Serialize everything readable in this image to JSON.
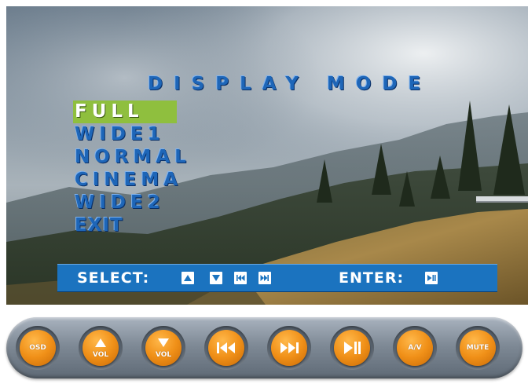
{
  "osd": {
    "title": "DISPLAY MODE",
    "items": [
      {
        "label": "FULL",
        "selected": true
      },
      {
        "label": "WIDE1",
        "selected": false
      },
      {
        "label": "NORMAL",
        "selected": false
      },
      {
        "label": "CINEMA",
        "selected": false
      },
      {
        "label": "WIDE2",
        "selected": false
      },
      {
        "label": "EXIT",
        "selected": false
      }
    ]
  },
  "status_bar": {
    "select_label": "SELECT:",
    "select_icons": [
      "up-key-icon",
      "down-key-icon",
      "rewind-key-icon",
      "fast-forward-key-icon"
    ],
    "enter_label": "ENTER:",
    "enter_icon": "play-pause-key-icon"
  },
  "remote": {
    "buttons": [
      {
        "name": "osd-button",
        "label": "OSD",
        "icon": "none"
      },
      {
        "name": "vol-up-button",
        "label": "VOL",
        "icon": "triangle-up-icon"
      },
      {
        "name": "vol-down-button",
        "label": "VOL",
        "icon": "triangle-down-icon"
      },
      {
        "name": "previous-button",
        "label": "",
        "icon": "skip-previous-icon"
      },
      {
        "name": "next-button",
        "label": "",
        "icon": "skip-next-icon"
      },
      {
        "name": "play-pause-button",
        "label": "",
        "icon": "play-pause-icon"
      },
      {
        "name": "av-button",
        "label": "A/V",
        "icon": "none"
      },
      {
        "name": "mute-button",
        "label": "MUTE",
        "icon": "none"
      }
    ]
  },
  "colors": {
    "menu_text": "#1e66b8",
    "selected_highlight": "#8fbf3e",
    "status_bar": "#1b73bf",
    "remote_button": "#f09018"
  }
}
